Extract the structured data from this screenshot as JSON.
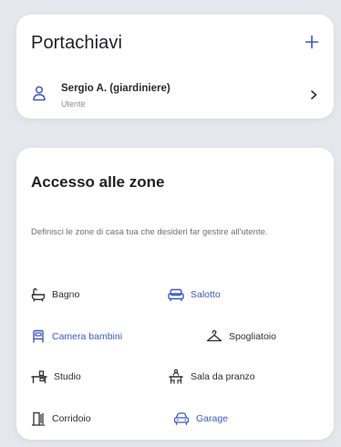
{
  "keys": {
    "title": "Portachiavi",
    "user": {
      "name": "Sergio A. (giardiniere)",
      "role": "Utente"
    }
  },
  "zones": {
    "title": "Accesso alle zone",
    "description": "Definisci le zone di casa tua che desideri far gestire all'utente.",
    "items": [
      {
        "label": "Bagno",
        "icon": "bathtub-icon",
        "active": false
      },
      {
        "label": "Salotto",
        "icon": "sofa-icon",
        "active": true
      },
      {
        "label": "Camera bambini",
        "icon": "bed-icon",
        "active": true
      },
      {
        "label": "Spogliatoio",
        "icon": "hanger-icon",
        "active": false
      },
      {
        "label": "Studio",
        "icon": "desk-icon",
        "active": false
      },
      {
        "label": "Sala da pranzo",
        "icon": "dining-table-icon",
        "active": false
      },
      {
        "label": "Corridoio",
        "icon": "door-icon",
        "active": false
      },
      {
        "label": "Garage",
        "icon": "car-icon",
        "active": true
      }
    ]
  },
  "colors": {
    "accent": "#3e57c4",
    "text": "#1f2023",
    "muted": "#8b8d93",
    "background": "#e6e7ec",
    "card": "#ffffff"
  }
}
